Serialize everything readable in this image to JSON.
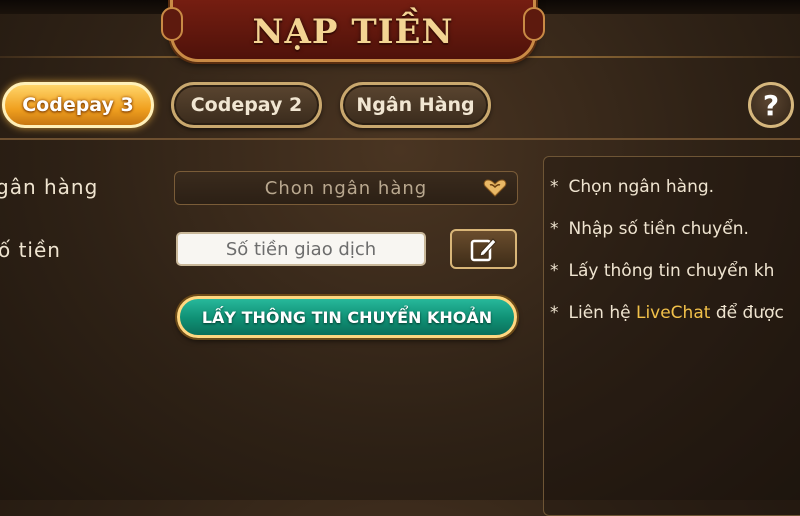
{
  "header": {
    "title": "NẠP TIỀN"
  },
  "tabs": [
    {
      "label": "Codepay 3",
      "active": true
    },
    {
      "label": "Codepay 2",
      "active": false
    },
    {
      "label": "Ngân Hàng",
      "active": false
    }
  ],
  "help": {
    "label": "?"
  },
  "form": {
    "bank_label": "gân hàng",
    "bank_placeholder": "Chon ngân hàng",
    "amount_label": "ố tiền",
    "amount_placeholder": "Số tiền giao dịch",
    "submit_label": "LẤY THÔNG TIN CHUYỂN KHOẢN"
  },
  "instructions": {
    "bullet": "*",
    "line1": "Chọn ngân hàng.",
    "line2": "Nhập số tiền chuyển.",
    "line3": "Lấy thông tin chuyển kh",
    "line4_prefix": "Liên hệ ",
    "line4_link": "LiveChat",
    "line4_suffix": " để được"
  },
  "icons": {
    "dropdown": "heart-dropdown-icon",
    "edit": "edit-icon"
  },
  "colors": {
    "accent_gold": "#f2c14a",
    "tab_active": "#f0a01f",
    "submit_green": "#0f8f74",
    "title_red": "#7a1f12"
  }
}
